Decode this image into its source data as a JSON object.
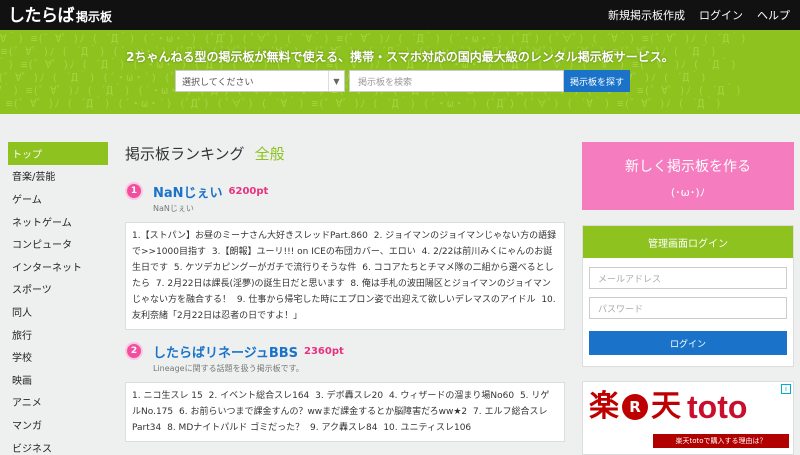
{
  "header": {
    "logo_main": "したらば",
    "logo_sub": "掲示板",
    "nav": [
      "新規掲示板作成",
      "ログイン",
      "ヘルプ"
    ]
  },
  "banner": {
    "pattern_text": "( ´∀｀) ≡(゜∀゜)ﾉ ( ´Д｀) (´・ω・`) (ﾟДﾟ) ( ﾟ∀ﾟ) ( ´∀｀) ≡(゜∀゜)ﾉ ( ´Д｀) (´・ω・`) (ﾟДﾟ) ( ﾟ∀ﾟ) ( ´∀｀) ≡(゜∀゜)ﾉ ( ´Д｀)",
    "tagline": "2ちゃんねる型の掲示板が無料で使える、携帯・スマホ対応の国内最大級のレンタル掲示板サービス。",
    "category_select": "選択してください",
    "search_placeholder": "掲示板を検索",
    "search_button": "掲示板を探す"
  },
  "sidebar": {
    "items": [
      "トップ",
      "音楽/芸能",
      "ゲーム",
      "ネットゲーム",
      "コンピュータ",
      "インターネット",
      "スポーツ",
      "同人",
      "旅行",
      "学校",
      "映画",
      "アニメ",
      "マンガ",
      "ビジネス"
    ]
  },
  "main": {
    "title": "掲示板ランキング",
    "title_accent": "全般",
    "rankings": [
      {
        "rank": "1",
        "name": "NaNじぇい",
        "points": "6200pt",
        "subtitle": "NaNじぇい",
        "threads": [
          "1.【ストパン】お昼のミーナさん大好きスレッドPart.860",
          "2. ジョイマンのジョイマンじゃない方の語録で>>1000目指す",
          "3.【朗報】ユーリ!!! on ICEの布団カバー、エロい",
          "4. 2/22は前川みくにゃんのお誕生日です",
          "5. ケツデカピングーがガチで流行りそうな件",
          "6. ココアたちとチマメ隊の二組から選べるとしたら",
          "7. 2月22日は課長(淫夢)の誕生日だと思います",
          "8. 俺は手札の波田陽区とジョイマンのジョイマンじゃない方を融合する！",
          "9. 仕事から帰宅した時にエプロン姿で出迎えて欲しいデレマスのアイドル",
          "10. 友利奈緒「2月22日は忍者の日ですよ！」"
        ]
      },
      {
        "rank": "2",
        "name": "したらばリネージュBBS",
        "points": "2360pt",
        "subtitle": "Lineageに関する話題を扱う掲示板です。",
        "threads": [
          "1. ニコ生スレ 15",
          "2. イベント総合スレ164",
          "3. デボ轟スレ20",
          "4. ウィザードの溜まり場No60",
          "5. リゲルNo.175",
          "6. お前らいつまで課金すんの？wwまだ課金するとか脳障害だろww★2",
          "7. エルフ総合スレ Part34",
          "8. MDナイトパルド ゴミだった？",
          "9. アク轟スレ84",
          "10. ユニティスレ106"
        ]
      }
    ]
  },
  "right": {
    "create_label": "新しく掲示板を作る",
    "create_face": "(･ω･)ﾉ",
    "login_title": "管理画面ログイン",
    "email_placeholder": "メールアドレス",
    "password_placeholder": "パスワード",
    "login_button": "ログイン"
  },
  "ad": {
    "brand_left": "楽",
    "brand_r": "R",
    "brand_right": "天",
    "brand_toto": "toto",
    "strip_text": "楽天totoで購入する理由は？"
  },
  "colors": {
    "brand_green": "#8dc21f",
    "link_blue": "#1a73c9",
    "pink": "#f47cbf",
    "points_pink": "#e8317f"
  }
}
